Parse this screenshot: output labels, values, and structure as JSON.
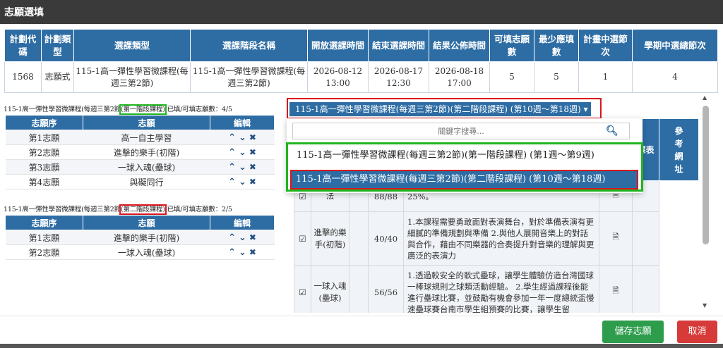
{
  "dialog": {
    "title": "志願選填"
  },
  "info": {
    "headers": [
      "計劃代碼",
      "計劃類型",
      "選課類型",
      "選課階段名稱",
      "開放選課時間",
      "結束選課時間",
      "結果公佈時間",
      "可填志願數",
      "最少應填數",
      "計畫中選節次",
      "學期中選總節次"
    ],
    "row": [
      "1568",
      "志願式",
      "115-1高一彈性學習微課程(每週三第2節)",
      "115-1高一彈性學習微課程(每週三第2節)",
      "2026-08-12 13:00",
      "2026-08-17 12:30",
      "2026-08-18 17:00",
      "5",
      "5",
      "1",
      "4"
    ]
  },
  "section1": {
    "prefix": "115-1高一彈性學習微課程(每週三第2節",
    "phase": "(第一階段課程)",
    "suffix": " 已填/可填志願數：4/5",
    "headers": [
      "志願序",
      "志願",
      "編輯"
    ],
    "rows": [
      {
        "order": "第1志願",
        "name": "高一自主學習"
      },
      {
        "order": "第2志願",
        "name": "進擊的樂手(初階)"
      },
      {
        "order": "第3志願",
        "name": "一球入魂(壘球)"
      },
      {
        "order": "第4志願",
        "name": "與礙同行"
      }
    ]
  },
  "section2": {
    "prefix": "115-1高一彈性學習微課程(每週三第2節",
    "phase": "(第二階段課程)",
    "suffix": " 已填/可填志願數：2/5",
    "headers": [
      "志願序",
      "志願",
      "編輯"
    ],
    "rows": [
      {
        "order": "第1志願",
        "name": "進擊的樂手(初階)"
      },
      {
        "order": "第2志願",
        "name": "一球入魂(壘球)"
      }
    ]
  },
  "actions": {
    "up": "⌃",
    "down": "⌄",
    "delete": "✖"
  },
  "stage_select": {
    "label": "115-1高一彈性學習微課程(每週三第2節)(第二階段課程) (第10週～第18週) ▾"
  },
  "dropdown": {
    "search_placeholder": "關鍵字搜尋...",
    "options": [
      "115-1高一彈性學習微課程(每週三第2節)(第一階段課程) (第1週～第9週)",
      "115-1高一彈性學習微課程(每週三第2節)(第二階段課程) (第10週～第18週)"
    ]
  },
  "course_table": {
    "headers": {
      "schedule": "課表",
      "reference": "參考網址"
    },
    "rows": [
      {
        "name": "法",
        "count": "88/88",
        "desc": "25%。"
      },
      {
        "name": "進擊的樂手(初階)",
        "count": "40/40",
        "desc": "1.本課程需要勇敢面對表演舞台，對於準備表演有更細膩的準備規劃與準備 2.與他人展開音樂上的對話與合作，藉由不同樂器的合奏提升對音樂的理解與更廣泛的表演力"
      },
      {
        "name": "一球入魂(壘球)",
        "count": "56/56",
        "desc": "1.透過較安全的軟式壘球，讓學生體驗仿造台灣國球一棒球規則之球類活動經驗。 2.學生經過課程後能進行壘球比賽，並鼓勵有機會參加一年一度總統盃慢速壘球賽台南市學生組預賽的比賽，讓學生留"
      }
    ]
  },
  "footer": {
    "save": "儲存志願",
    "cancel": "取消"
  },
  "colors": {
    "header": "#2e6da4",
    "highlight_green": "#1fb51f",
    "highlight_red": "#d9181e",
    "save": "#2d9d4c",
    "cancel": "#d63b3a"
  }
}
